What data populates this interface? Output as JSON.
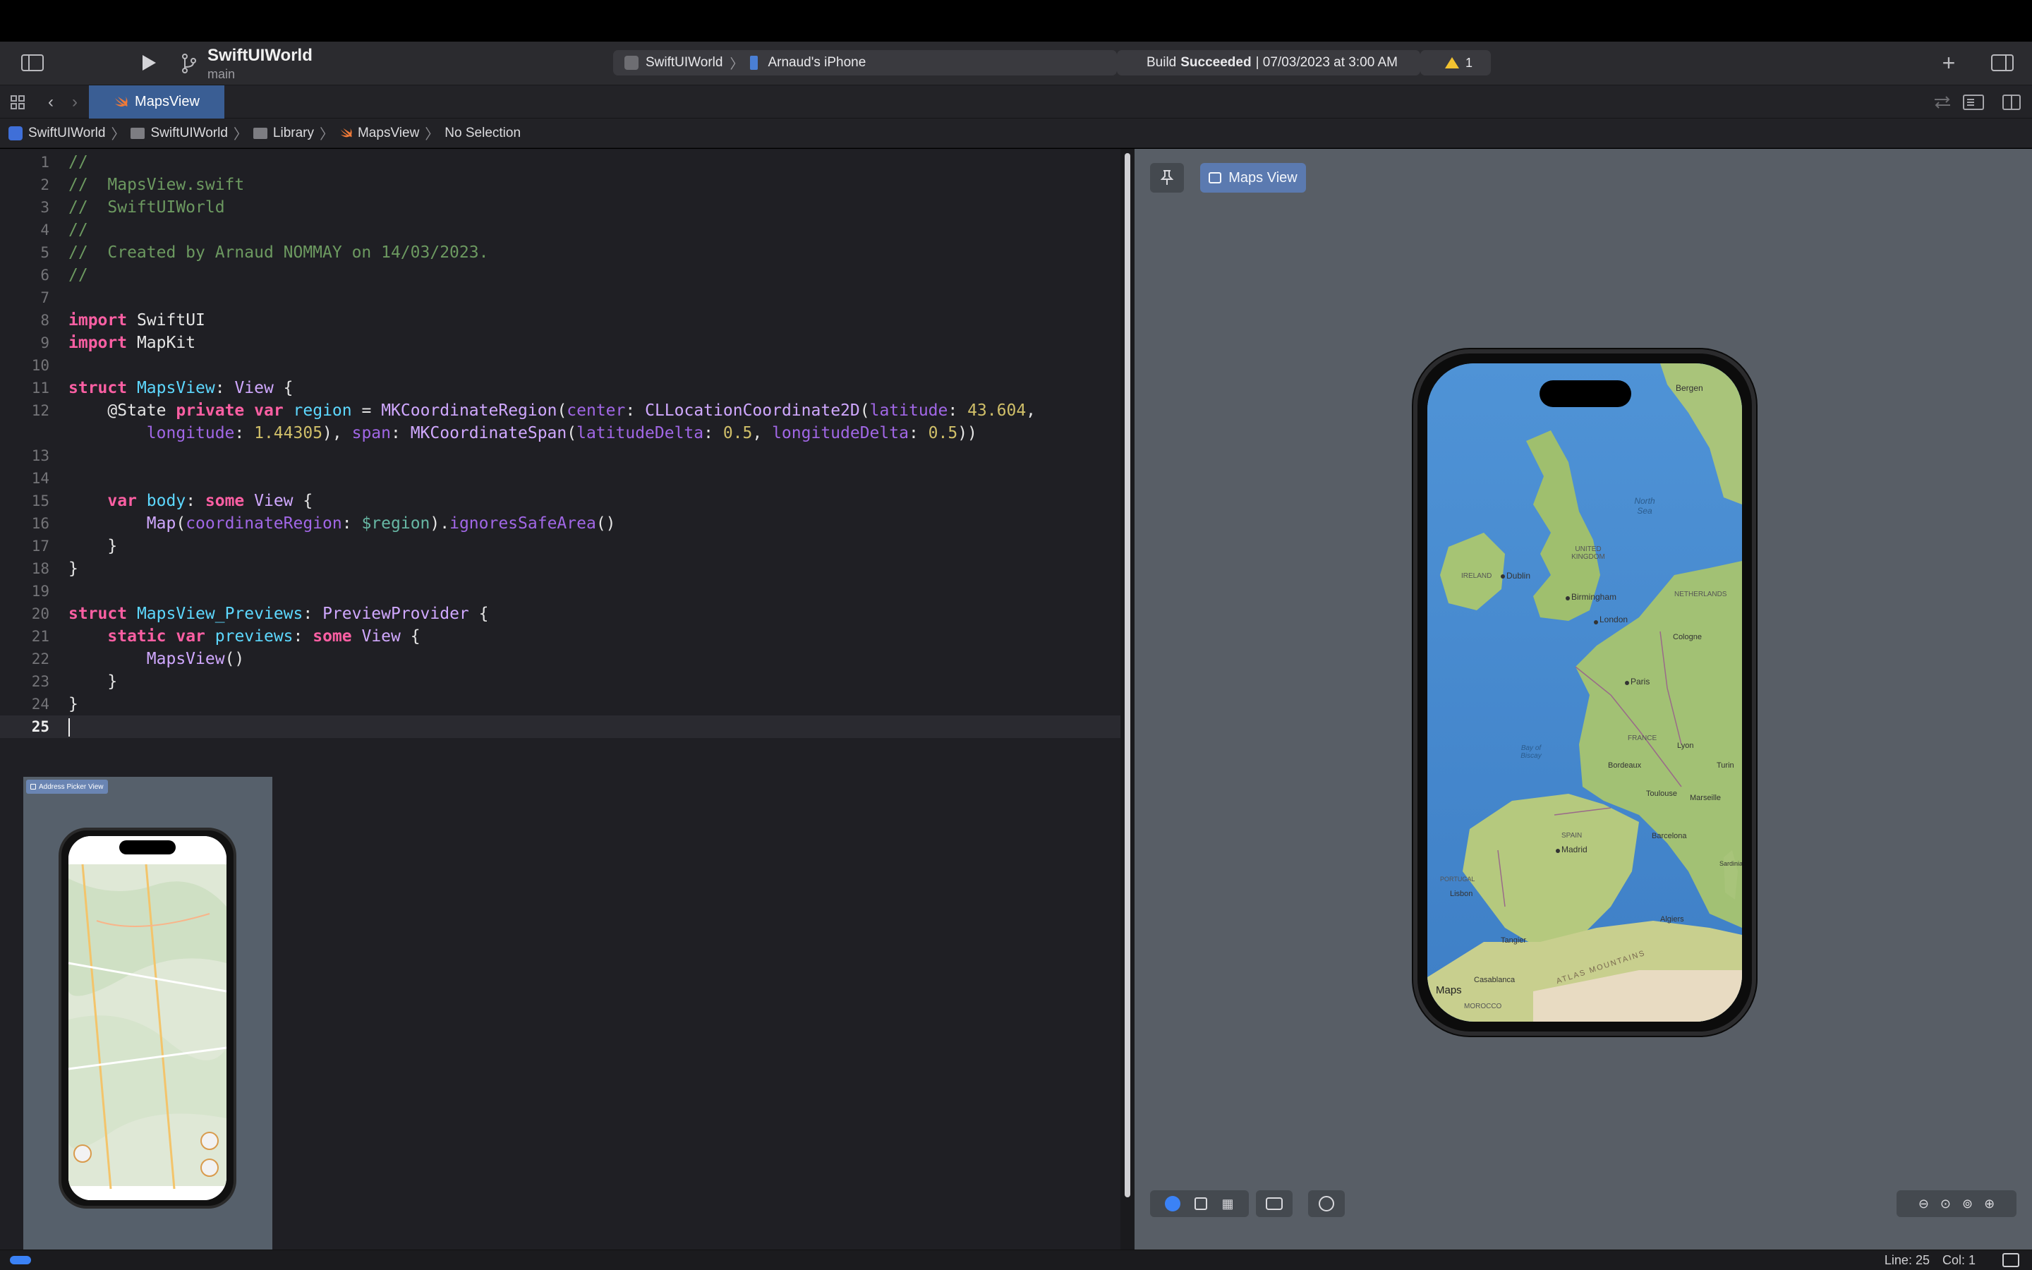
{
  "toolbar": {
    "project_name": "SwiftUIWorld",
    "branch": "main",
    "scheme": {
      "project": "SwiftUIWorld",
      "device": "Arnaud's iPhone"
    },
    "build_status": {
      "prefix": "Build",
      "status": "Succeeded",
      "suffix": "| 07/03/2023 at 3:00 AM"
    },
    "warning_count": "1"
  },
  "tab": {
    "label": "MapsView"
  },
  "breadcrumb": [
    "SwiftUIWorld",
    "SwiftUIWorld",
    "Library",
    "MapsView",
    "No Selection"
  ],
  "editor": {
    "line_numbers": [
      "1",
      "2",
      "3",
      "4",
      "5",
      "6",
      "7",
      "8",
      "9",
      "10",
      "11",
      "12",
      "",
      "13",
      "14",
      "15",
      "16",
      "17",
      "18",
      "19",
      "20",
      "21",
      "22",
      "23",
      "24",
      "25"
    ],
    "current_line": "25"
  },
  "mini_preview": {
    "label": "Address Picker View"
  },
  "canvas": {
    "preview_label": "Maps View",
    "map": {
      "labels": [
        "Bergen",
        "North Sea",
        "UNITED KINGDOM",
        "IRELAND",
        "Dublin",
        "Birmingham",
        "London",
        "NETHERLANDS",
        "Cologne",
        "Paris",
        "FRANCE",
        "Lyon",
        "Bay of Biscay",
        "Bordeaux",
        "Toulouse",
        "Marseille",
        "Turin",
        "SPAIN",
        "Madrid",
        "Barcelona",
        "PORTUGAL",
        "Lisbon",
        "Tangier",
        "Algiers",
        "Casablanca",
        "MOROCCO",
        "ATLAS MOUNTAINS",
        "Sardinia"
      ],
      "attribution": "Maps"
    }
  },
  "statusbar": {
    "line": "Line: 25",
    "col": "Col: 1"
  },
  "colors": {
    "accent": "#3a5e94",
    "editor_bg": "#1f1f24",
    "canvas_bg": "#585e66",
    "keyword": "#fc5fa3",
    "comment": "#6c9960",
    "number": "#d0bf69"
  }
}
